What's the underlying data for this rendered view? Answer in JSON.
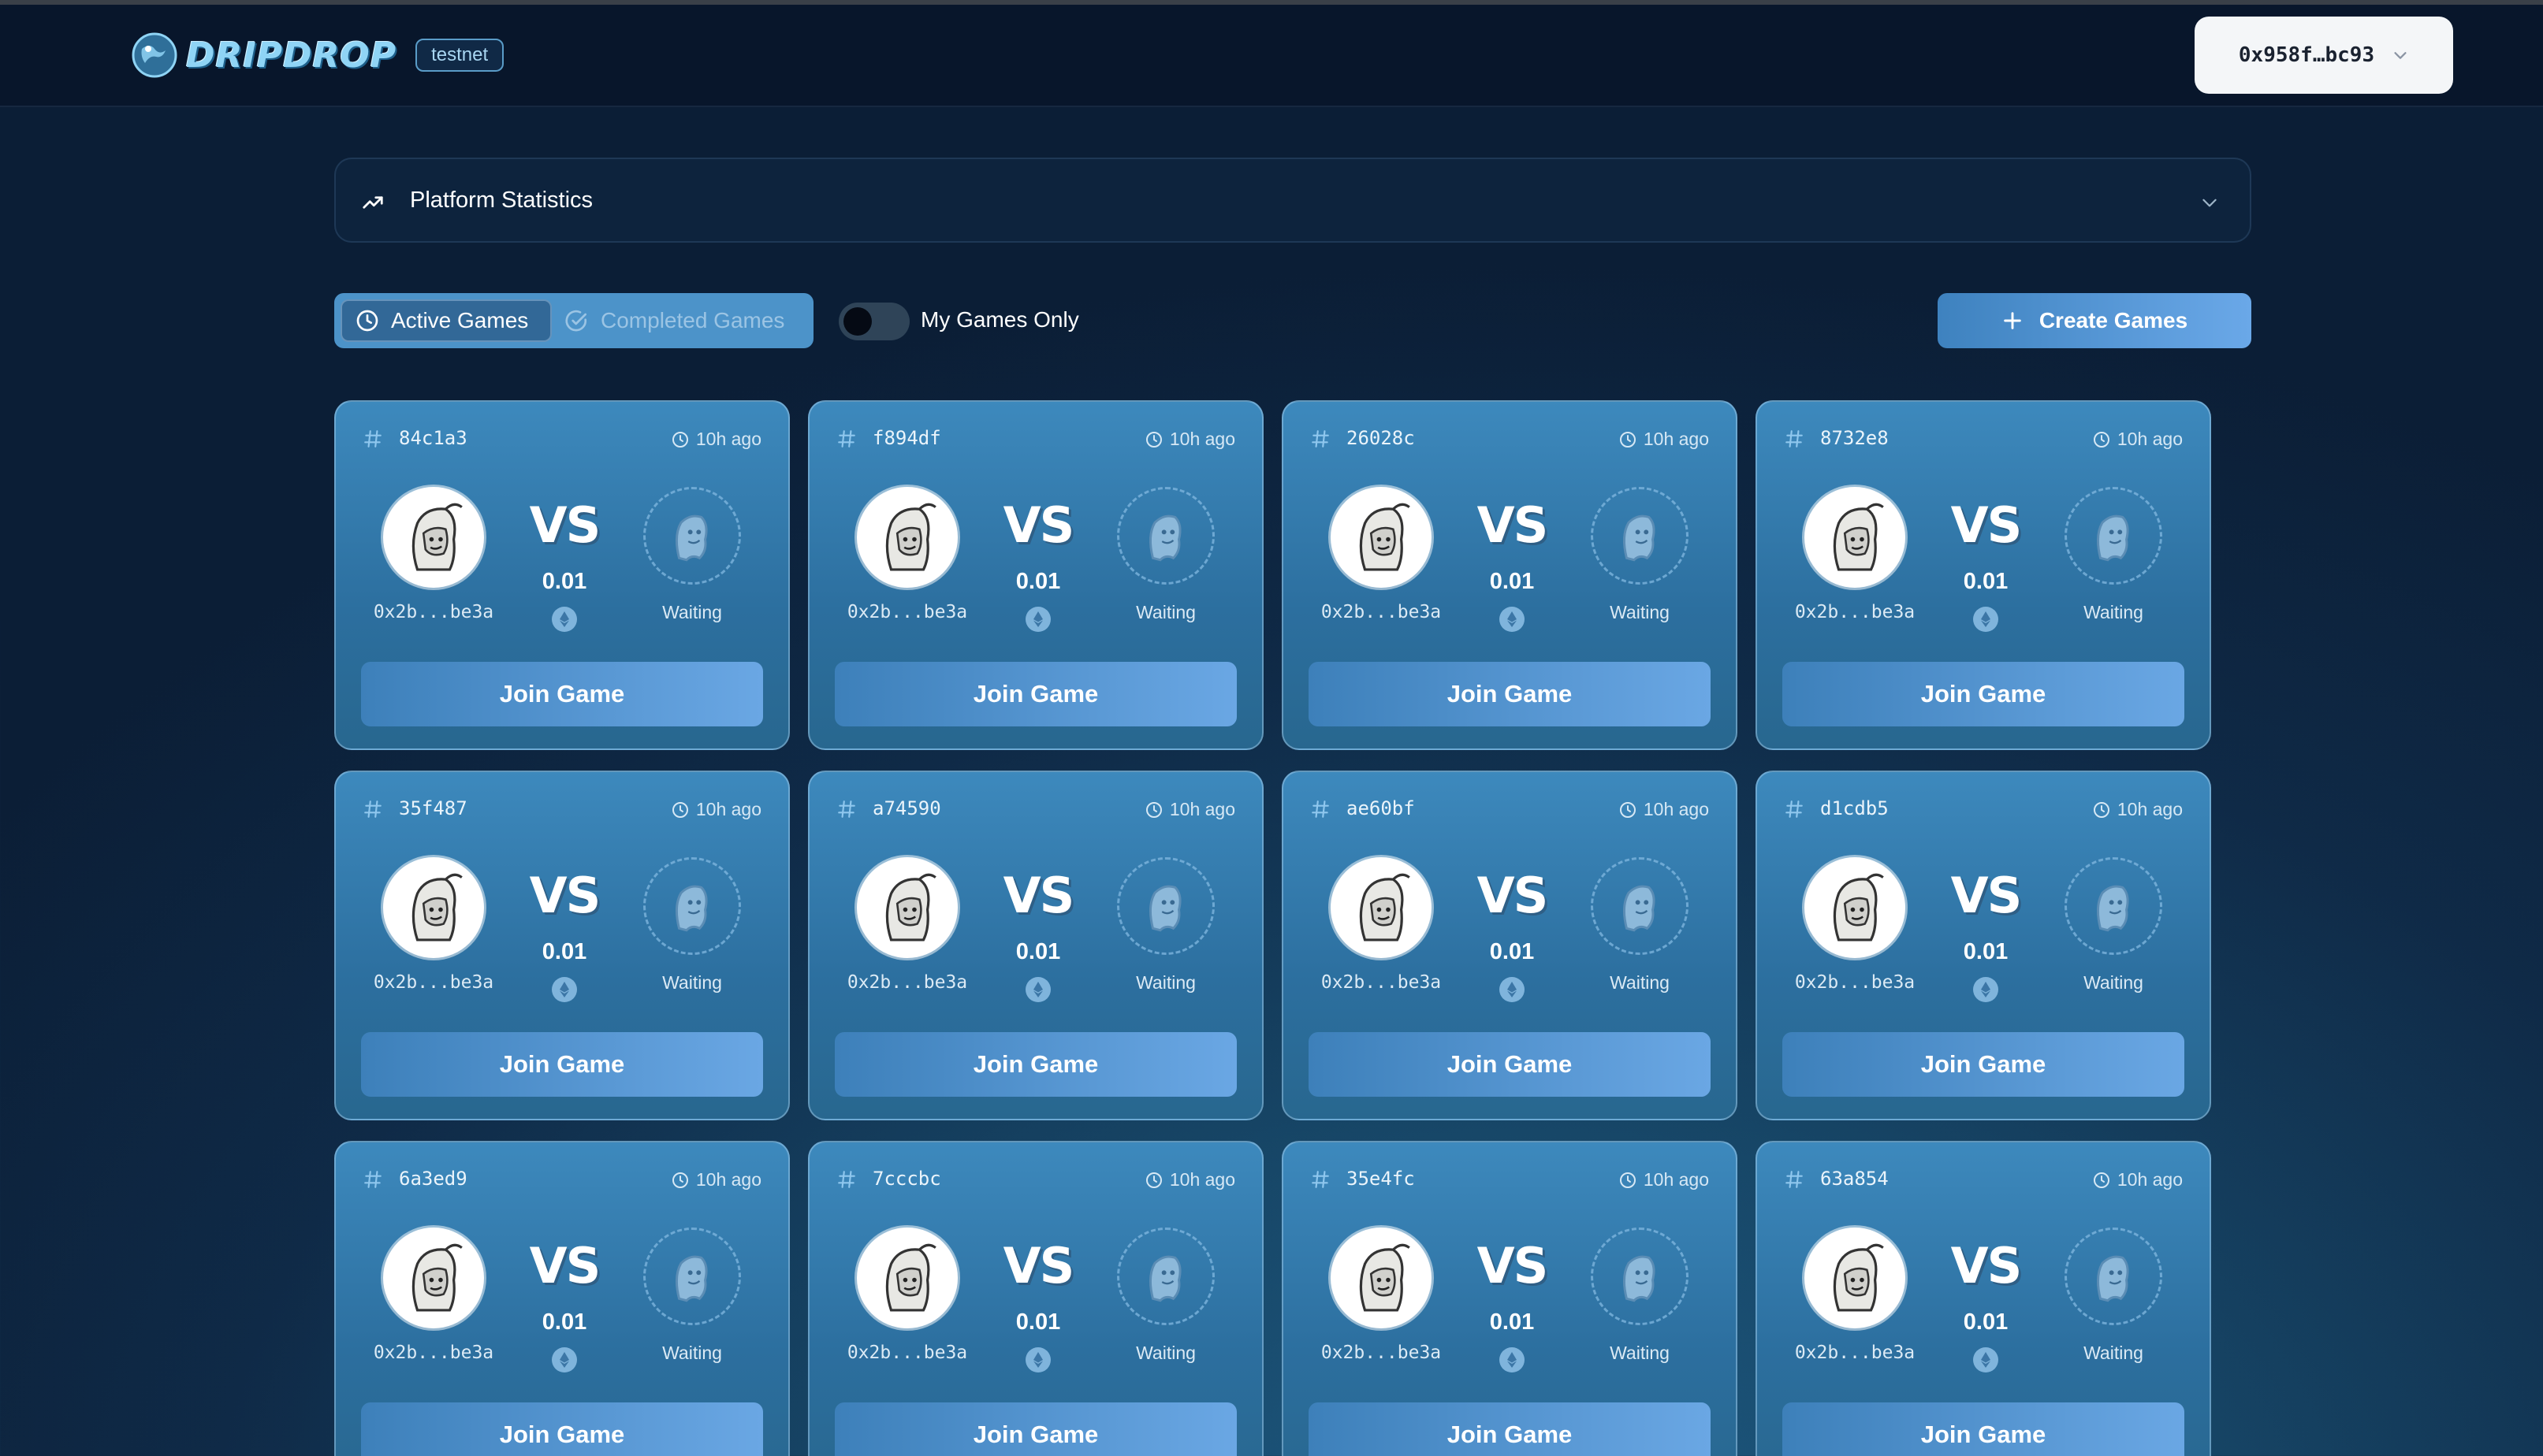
{
  "header": {
    "logo_text": "DRIPDROP",
    "network_badge": "testnet",
    "wallet_address": "0x958f…bc93"
  },
  "stats_panel": {
    "label": "Platform Statistics"
  },
  "filters": {
    "tabs": [
      {
        "label": "Active Games",
        "active": true
      },
      {
        "label": "Completed Games",
        "active": false
      }
    ],
    "toggle_label": "My Games Only",
    "toggle_on": false
  },
  "create_button_label": "Create Games",
  "games": [
    {
      "id": "84c1a3",
      "time": "10h ago",
      "vs": "VS",
      "amount": "0.01",
      "creator": "0x2b...be3a",
      "opponent_status": "Waiting",
      "join_label": "Join Game"
    },
    {
      "id": "f894df",
      "time": "10h ago",
      "vs": "VS",
      "amount": "0.01",
      "creator": "0x2b...be3a",
      "opponent_status": "Waiting",
      "join_label": "Join Game"
    },
    {
      "id": "26028c",
      "time": "10h ago",
      "vs": "VS",
      "amount": "0.01",
      "creator": "0x2b...be3a",
      "opponent_status": "Waiting",
      "join_label": "Join Game"
    },
    {
      "id": "8732e8",
      "time": "10h ago",
      "vs": "VS",
      "amount": "0.01",
      "creator": "0x2b...be3a",
      "opponent_status": "Waiting",
      "join_label": "Join Game"
    },
    {
      "id": "35f487",
      "time": "10h ago",
      "vs": "VS",
      "amount": "0.01",
      "creator": "0x2b...be3a",
      "opponent_status": "Waiting",
      "join_label": "Join Game"
    },
    {
      "id": "a74590",
      "time": "10h ago",
      "vs": "VS",
      "amount": "0.01",
      "creator": "0x2b...be3a",
      "opponent_status": "Waiting",
      "join_label": "Join Game"
    },
    {
      "id": "ae60bf",
      "time": "10h ago",
      "vs": "VS",
      "amount": "0.01",
      "creator": "0x2b...be3a",
      "opponent_status": "Waiting",
      "join_label": "Join Game"
    },
    {
      "id": "d1cdb5",
      "time": "10h ago",
      "vs": "VS",
      "amount": "0.01",
      "creator": "0x2b...be3a",
      "opponent_status": "Waiting",
      "join_label": "Join Game"
    },
    {
      "id": "6a3ed9",
      "time": "10h ago",
      "vs": "VS",
      "amount": "0.01",
      "creator": "0x2b...be3a",
      "opponent_status": "Waiting",
      "join_label": "Join Game"
    },
    {
      "id": "7cccbc",
      "time": "10h ago",
      "vs": "VS",
      "amount": "0.01",
      "creator": "0x2b...be3a",
      "opponent_status": "Waiting",
      "join_label": "Join Game"
    },
    {
      "id": "35e4fc",
      "time": "10h ago",
      "vs": "VS",
      "amount": "0.01",
      "creator": "0x2b...be3a",
      "opponent_status": "Waiting",
      "join_label": "Join Game"
    },
    {
      "id": "63a854",
      "time": "10h ago",
      "vs": "VS",
      "amount": "0.01",
      "creator": "0x2b...be3a",
      "opponent_status": "Waiting",
      "join_label": "Join Game"
    }
  ],
  "icons": {
    "logo": "globe-drop-icon",
    "wallet_chevron": "chevron-down-icon",
    "stats": "trending-up-icon",
    "stats_chevron": "chevron-down-icon",
    "active_tab": "clock-icon",
    "completed_tab": "check-circle-icon",
    "create": "plus-icon",
    "game_id": "hash-icon",
    "time": "clock-icon",
    "currency": "eth-icon",
    "creator_avatar": "hooded-character-icon",
    "opponent_avatar": "ghost-character-icon"
  },
  "colors": {
    "accent": "#4c93c9",
    "card_bg": "#3d89bd",
    "button_start": "#3d80ba",
    "button_end": "#6aa7e4"
  }
}
